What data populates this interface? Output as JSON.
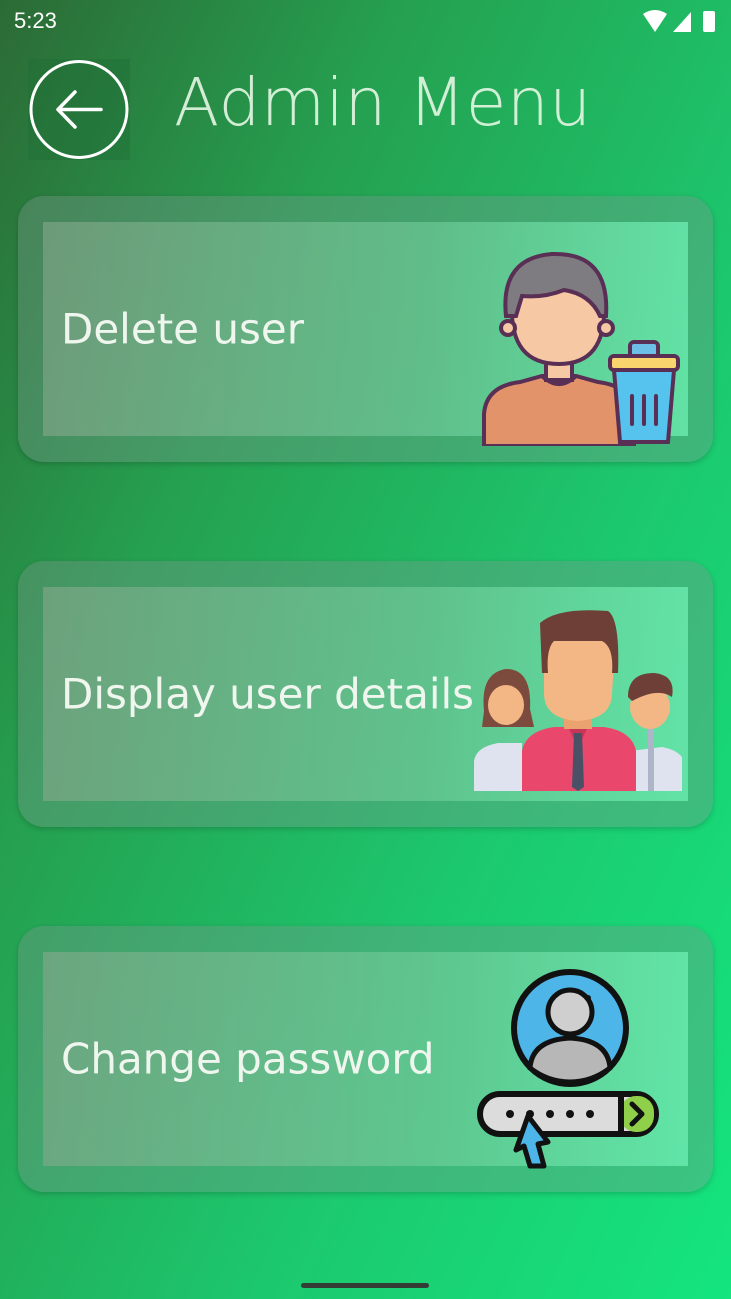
{
  "status_bar": {
    "time": "5:23"
  },
  "header": {
    "title": "Admin Menu"
  },
  "menu": {
    "items": [
      {
        "label": "Delete user",
        "icon": "delete-user-icon"
      },
      {
        "label": "Display user details",
        "icon": "users-group-icon"
      },
      {
        "label": "Change password",
        "icon": "password-user-icon"
      }
    ]
  }
}
